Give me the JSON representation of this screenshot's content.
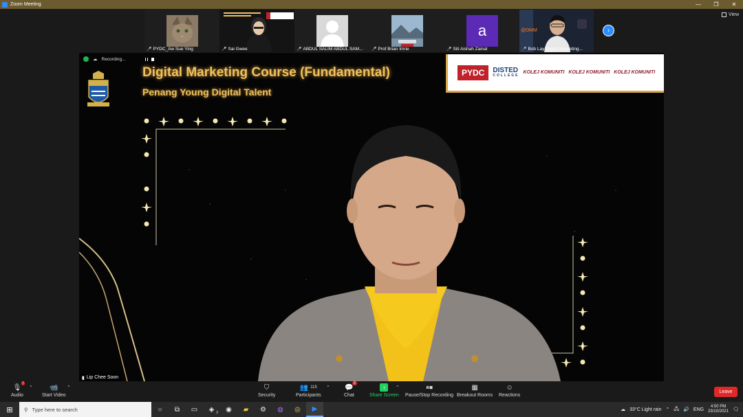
{
  "window": {
    "title": "Zoom Meeting",
    "controls": [
      "—",
      "❐",
      "✕"
    ]
  },
  "view_button": {
    "label": "View"
  },
  "participants_strip": [
    {
      "name": "PYDC_Aw Sue Ying",
      "muted": true,
      "thumb": "cat-photo"
    },
    {
      "name": "Sai Gwee",
      "muted": true,
      "thumb": "woman-video"
    },
    {
      "name": "ABDUL SALIM ABDUL SAM...",
      "muted": true,
      "thumb": "default-avatar"
    },
    {
      "name": "Prof Brian Imrie",
      "muted": true,
      "thumb": "landscape"
    },
    {
      "name": "Siti Aishah Zainal",
      "muted": true,
      "thumb": "letter-a",
      "letter": "a"
    },
    {
      "name": "Bob Lay Digital Marketing...",
      "muted": true,
      "thumb": "man-video"
    }
  ],
  "recording": {
    "label": "Recording..."
  },
  "slide": {
    "title": "Digital Marketing Course (Fundamental)",
    "subtitle": "Penang Young Digital Talent",
    "logos": {
      "pydc": "PYDC",
      "disted": "DISTED",
      "disted_sub": "COLLEGE",
      "kk": [
        "KOLEJ KOMUNITI",
        "KOLEJ KOMUNITI",
        "KOLEJ KOMUNITI"
      ]
    }
  },
  "active_speaker": {
    "name": "Lip Chee Soon"
  },
  "toolbar": {
    "audio": "Audio",
    "start_video": "Start Video",
    "security": "Security",
    "participants": "Participants",
    "participants_count": "115",
    "chat": "Chat",
    "chat_badge": "2",
    "share_screen": "Share Screen",
    "recording": "Pause/Stop Recording",
    "breakout": "Breakout Rooms",
    "reactions": "Reactions",
    "leave": "Leave"
  },
  "taskbar": {
    "search_placeholder": "Type here to search",
    "weather": "33°C  Light rain",
    "lang": "ENG",
    "time": "4:50 PM",
    "date": "23/10/2021",
    "badge_app": "2"
  },
  "colors": {
    "accent": "#2d8cff",
    "leave": "#e02828",
    "slide_gold": "#f1c15b",
    "share_green": "#23d160"
  }
}
